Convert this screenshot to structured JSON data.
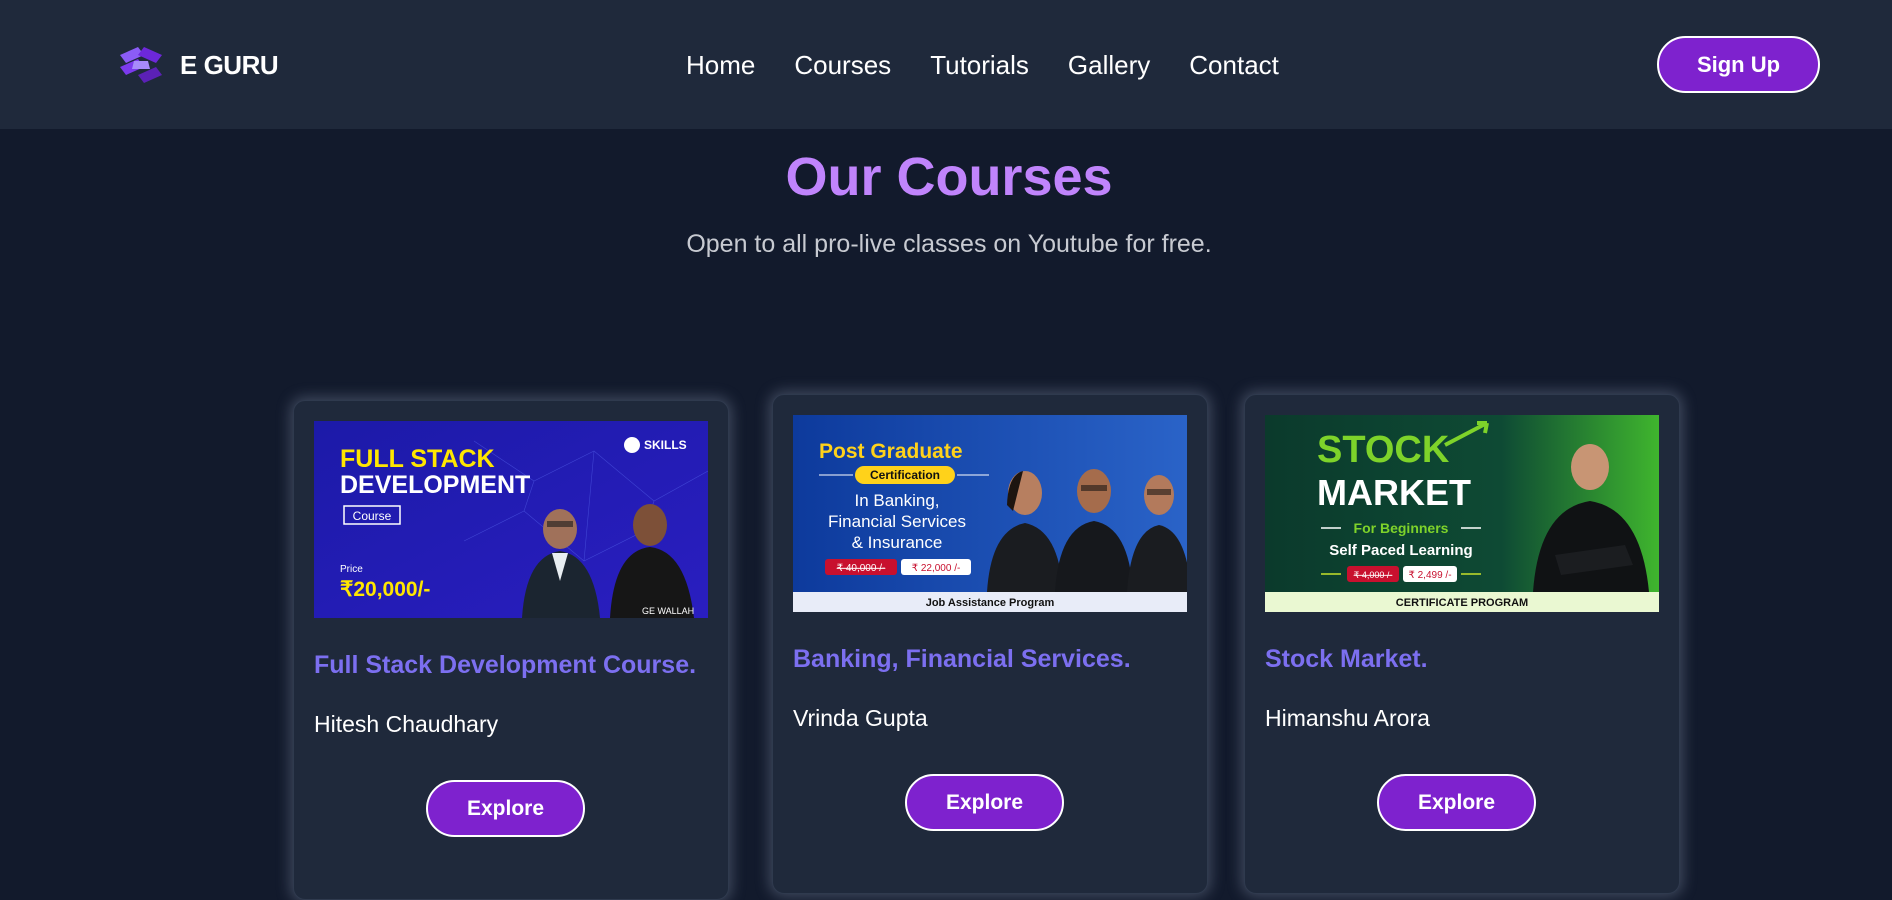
{
  "brand": {
    "name": "E GURU"
  },
  "nav": {
    "items": [
      "Home",
      "Courses",
      "Tutorials",
      "Gallery",
      "Contact"
    ]
  },
  "header": {
    "signup_label": "Sign Up"
  },
  "hero": {
    "title": "Our Courses",
    "subtitle": "Open to all pro-live classes on Youtube for free."
  },
  "courses": [
    {
      "title": "Full Stack Development Course.",
      "author": "Hitesh Chaudhary",
      "button": "Explore",
      "banner": {
        "line1": "FULL STACK",
        "line2": "DEVELOPMENT",
        "tag": "Course",
        "price_label": "Price",
        "price": "₹20,000/-",
        "brand": "SKILLS",
        "shirt": "GE WALLAH"
      }
    },
    {
      "title": "Banking, Financial Services.",
      "author": "Vrinda Gupta",
      "button": "Explore",
      "banner": {
        "line1": "Post Graduate",
        "tag": "Certification",
        "line2": "In Banking,",
        "line3": "Financial Services",
        "line4": "& Insurance",
        "old_price": "₹ 40,000 /-",
        "price": "₹ 22,000 /-",
        "footer": "Job Assistance Program"
      }
    },
    {
      "title": "Stock Market.",
      "author": "Himanshu Arora",
      "button": "Explore",
      "banner": {
        "line1": "STOCK",
        "line2": "MARKET",
        "tag": "For Beginners",
        "line3": "Self Paced Learning",
        "old_price": "₹ 4,000 /-",
        "price": "₹ 2,499 /-",
        "footer": "CERTIFICATE PROGRAM"
      }
    }
  ],
  "colors": {
    "header_bg": "#1f293b",
    "page_bg": "#121a2c",
    "accent": "#7e22ce",
    "title": "#c084fc",
    "card_title": "#7c6ff0"
  }
}
